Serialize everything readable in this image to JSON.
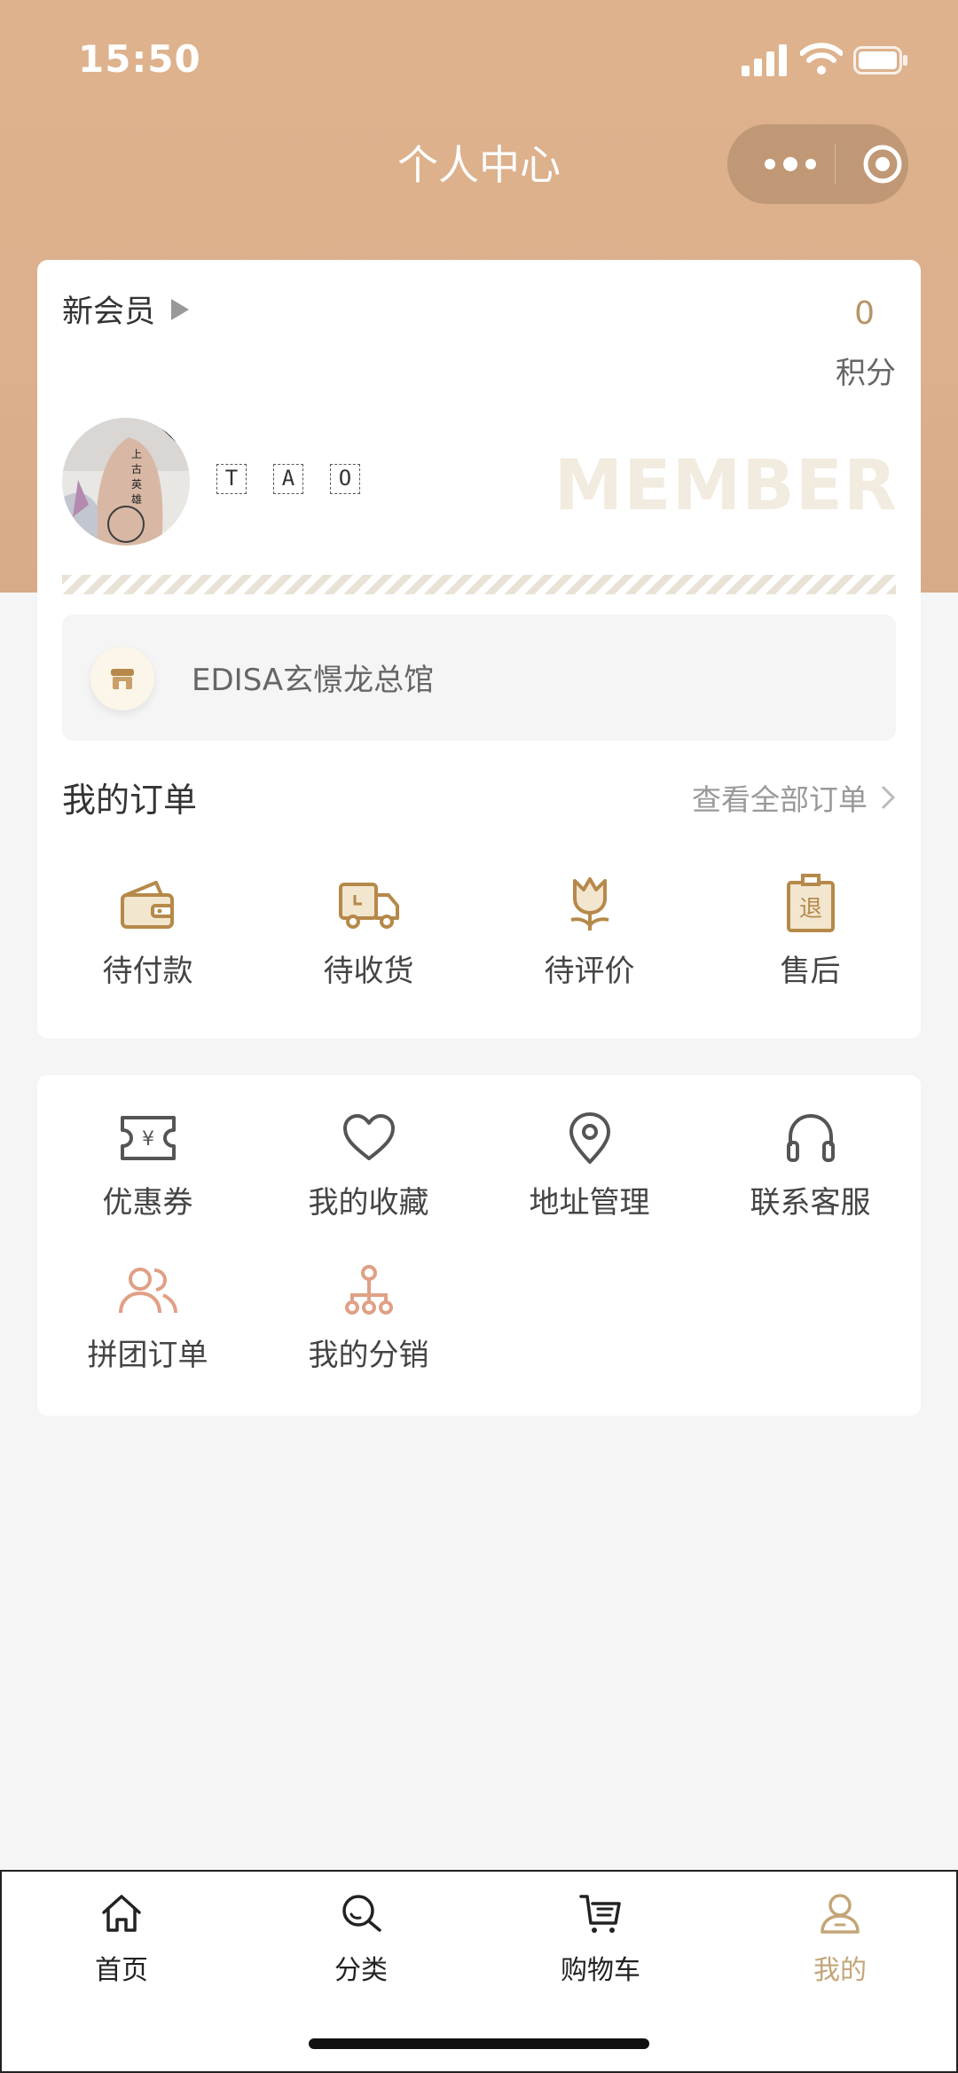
{
  "status_bar": {
    "time": "15:50"
  },
  "nav": {
    "title": "个人中心"
  },
  "member_card": {
    "level": "新会员",
    "points_value": "0",
    "points_label": "积分",
    "nickname_chars": [
      "T",
      "A",
      "O"
    ],
    "watermark": "MEMBER"
  },
  "store": {
    "name": "EDISA玄憬龙总馆"
  },
  "orders": {
    "title": "我的订单",
    "view_all": "查看全部订单",
    "items": [
      {
        "label": "待付款",
        "icon": "wallet-icon"
      },
      {
        "label": "待收货",
        "icon": "truck-icon"
      },
      {
        "label": "待评价",
        "icon": "flower-icon"
      },
      {
        "label": "售后",
        "icon": "return-icon"
      }
    ]
  },
  "services": {
    "items": [
      {
        "label": "优惠券",
        "icon": "coupon-icon"
      },
      {
        "label": "我的收藏",
        "icon": "heart-icon"
      },
      {
        "label": "地址管理",
        "icon": "location-icon"
      },
      {
        "label": "联系客服",
        "icon": "headset-icon"
      },
      {
        "label": "拼团订单",
        "icon": "group-icon"
      },
      {
        "label": "我的分销",
        "icon": "network-icon"
      }
    ]
  },
  "tabbar": {
    "items": [
      {
        "label": "首页",
        "icon": "home-icon"
      },
      {
        "label": "分类",
        "icon": "search-icon"
      },
      {
        "label": "购物车",
        "icon": "cart-icon"
      },
      {
        "label": "我的",
        "icon": "user-icon",
        "active": true
      }
    ]
  },
  "colors": {
    "header": "#ddb28d",
    "accent": "#c3a578",
    "icon_gold": "#b6894a",
    "icon_gray": "#555555",
    "icon_salmon": "#e0a085"
  }
}
